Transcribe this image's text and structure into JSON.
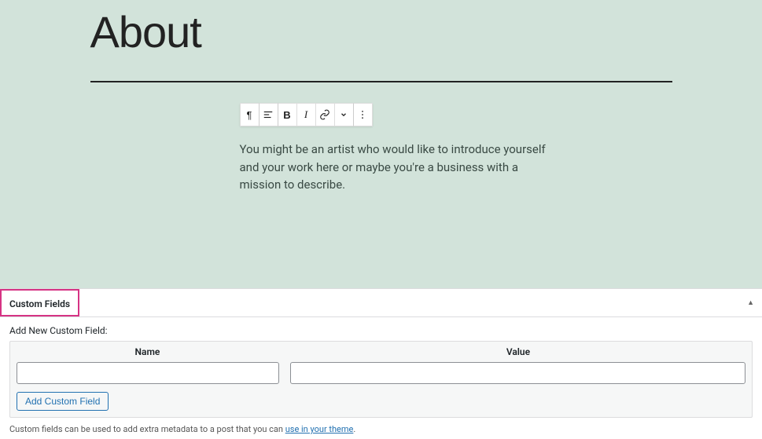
{
  "editor": {
    "page_title": "About",
    "paragraph": "You might be an artist who would like to introduce yourself and your work here or maybe you're a business with a mission to describe.",
    "toolbar": {
      "paragraph_icon": "¶",
      "bold_label": "B",
      "italic_label": "I"
    }
  },
  "custom_fields": {
    "panel_title": "Custom Fields",
    "add_new_label": "Add New Custom Field:",
    "col_name": "Name",
    "col_value": "Value",
    "name_value": "",
    "value_value": "",
    "add_button": "Add Custom Field",
    "help_prefix": "Custom fields can be used to add extra metadata to a post that you can ",
    "help_link": "use in your theme",
    "help_suffix": "."
  }
}
